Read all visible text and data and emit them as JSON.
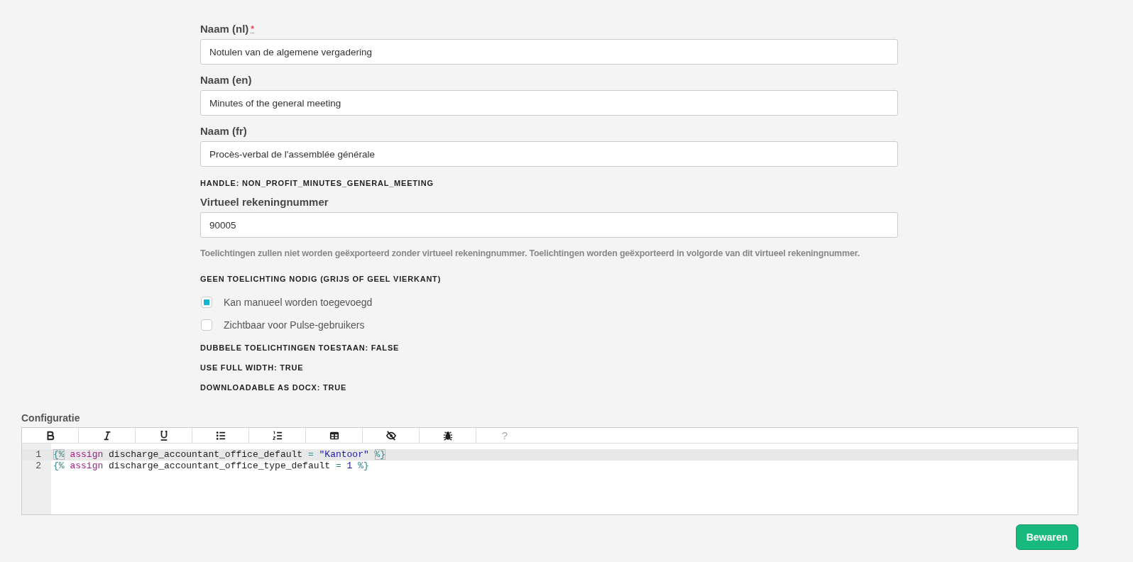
{
  "form": [
    {
      "kind": "field",
      "label": "Naam (nl)",
      "required_mark": "*",
      "value": "Notulen van de algemene vergadering"
    },
    {
      "kind": "field",
      "label": "Naam (en)",
      "value": "Minutes of the general meeting"
    },
    {
      "kind": "field",
      "label": "Naam (fr)",
      "value": "Procès-verbal de l'assemblée générale"
    },
    {
      "kind": "info",
      "text": "HANDLE: NON_PROFIT_MINUTES_GENERAL_MEETING"
    },
    {
      "kind": "field",
      "label": "Virtueel rekeningnummer",
      "value": "90005"
    },
    {
      "kind": "help",
      "text": "Toelichtingen zullen niet worden geëxporteerd zonder virtueel rekeningnummer. Toelichtingen worden geëxporteerd in volgorde van dit virtueel rekeningnummer."
    },
    {
      "kind": "checkgroup",
      "text": "GEEN TOELICHTING NODIG (GRIJS OF GEEL VIERKANT)",
      "options": [
        {
          "label": "Kan manueel worden toegevoegd",
          "checked": true
        },
        {
          "label": "Zichtbaar voor Pulse-gebruikers",
          "checked": false
        }
      ]
    },
    {
      "kind": "info",
      "text": "DUBBELE TOELICHTINGEN TOESTAAN: FALSE"
    },
    {
      "kind": "info",
      "text": "USE FULL WIDTH: TRUE"
    },
    {
      "kind": "info",
      "text": "DOWNLOADABLE AS DOCX: TRUE"
    }
  ],
  "editor": {
    "label": "Configuratie",
    "help_button": "?",
    "lines": [
      {
        "number": "1",
        "active": true,
        "tokens": [
          {
            "kind": "bracket",
            "text": "{%"
          },
          {
            "kind": "keyword",
            "text": "assign"
          },
          {
            "kind": "plain",
            "text": "discharge_accountant_office_default"
          },
          {
            "kind": "operator",
            "text": "="
          },
          {
            "kind": "string",
            "text": "\"Kantoor\""
          },
          {
            "kind": "bracket",
            "text": "%}"
          }
        ]
      },
      {
        "number": "2",
        "active": false,
        "tokens": [
          {
            "kind": "tag",
            "text": "{%"
          },
          {
            "kind": "keyword",
            "text": "assign"
          },
          {
            "kind": "plain",
            "text": "discharge_accountant_office_type_default"
          },
          {
            "kind": "operator",
            "text": "="
          },
          {
            "kind": "number",
            "text": "1"
          },
          {
            "kind": "tag",
            "text": "%}"
          }
        ]
      }
    ]
  },
  "save_button": "Bewaren"
}
